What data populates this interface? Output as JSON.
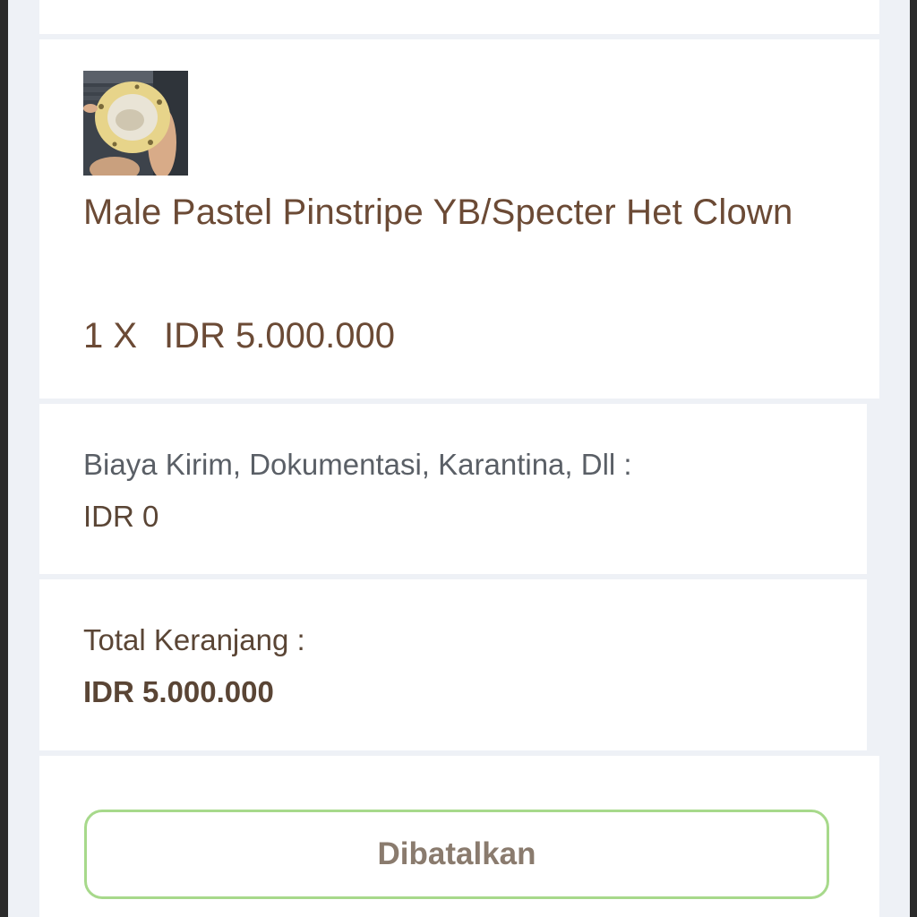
{
  "product": {
    "name": "Male Pastel Pinstripe YB/Specter Het Clown",
    "quantity": "1 X",
    "price": "IDR 5.000.000",
    "image_alt": "snake-photo"
  },
  "shipping": {
    "label": "Biaya Kirim, Dokumentasi, Karantina, Dll :",
    "value": "IDR 0"
  },
  "total": {
    "label": "Total Keranjang :",
    "value": "IDR 5.000.000"
  },
  "status_button": {
    "label": "Dibatalkan",
    "border_color": "#a7d98b"
  },
  "colors": {
    "text_brown": "#6b4a35",
    "text_gray": "#5a5f66",
    "background": "#eef1f6"
  }
}
